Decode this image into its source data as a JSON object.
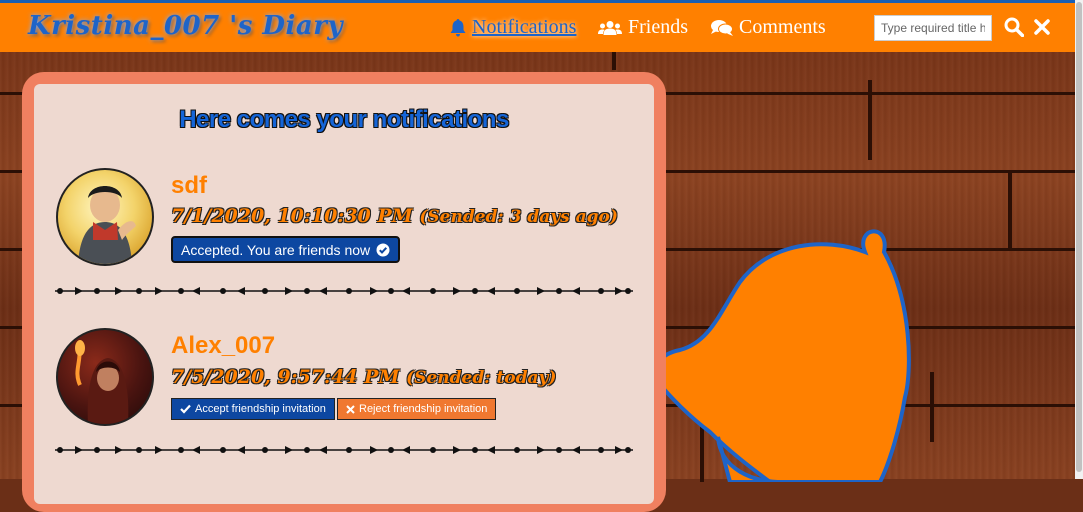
{
  "header": {
    "brand": "Kristina_007 's Diary",
    "nav": [
      {
        "label": "Notifications",
        "icon": "bell-icon",
        "active": true
      },
      {
        "label": "Friends",
        "icon": "users-icon"
      },
      {
        "label": "Comments",
        "icon": "comments-icon"
      }
    ],
    "search_placeholder": "Type required title here"
  },
  "main": {
    "title": "Here comes your notifications",
    "notifications": [
      {
        "username": "sdf",
        "datetime": "7/1/2020, 10:10:30 PM",
        "sent": "(Sended: 3 days ago)",
        "status": "Accepted. You are friends now"
      },
      {
        "username": "Alex_007",
        "datetime": "7/5/2020, 9:57:44 PM",
        "sent": "(Sended: today)",
        "accept_label": "Accept friendship invitation",
        "reject_label": "Reject friendship invitation"
      }
    ]
  },
  "colors": {
    "header": "#ff8000",
    "accent_blue": "#1565d8",
    "panel": "#eed9d0"
  }
}
